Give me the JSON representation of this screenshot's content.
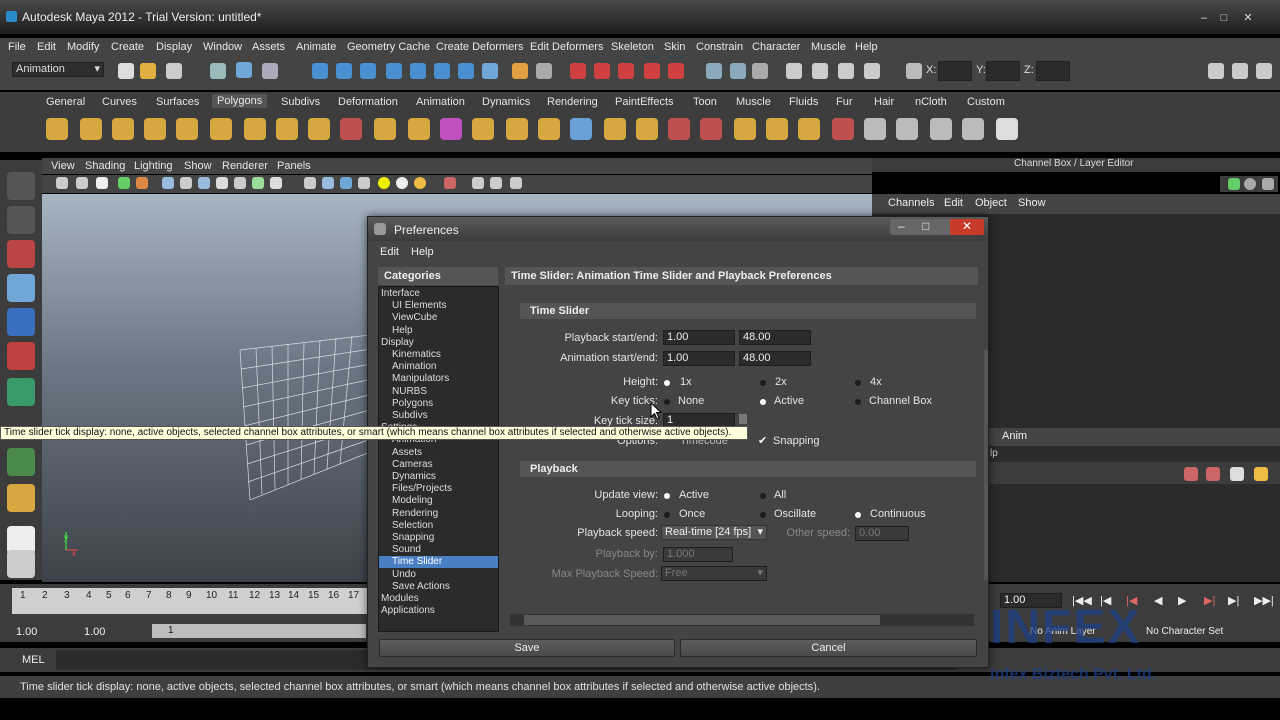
{
  "window": {
    "title": "Autodesk Maya 2012 - Trial Version: untitled*"
  },
  "menubar": [
    "File",
    "Edit",
    "Modify",
    "Create",
    "Display",
    "Window",
    "Assets",
    "Animate",
    "Geometry Cache",
    "Create Deformers",
    "Edit Deformers",
    "Skeleton",
    "Skin",
    "Constrain",
    "Character",
    "Muscle",
    "Help"
  ],
  "toolbar": {
    "mode": "Animation",
    "x_label": "X:",
    "y_label": "Y:",
    "z_label": "Z:"
  },
  "shelf_tabs": [
    "General",
    "Curves",
    "Surfaces",
    "Polygons",
    "Subdivs",
    "Deformation",
    "Animation",
    "Dynamics",
    "Rendering",
    "PaintEffects",
    "Toon",
    "Muscle",
    "Fluids",
    "Fur",
    "Hair",
    "nCloth",
    "Custom"
  ],
  "shelf_active": "Polygons",
  "panel_menu": [
    "View",
    "Shading",
    "Lighting",
    "Show",
    "Renderer",
    "Panels"
  ],
  "channel_box": {
    "title": "Channel Box / Layer Editor",
    "menu": [
      "Channels",
      "Edit",
      "Object",
      "Show"
    ],
    "layer_tab": "Anim",
    "layer_help": "lp"
  },
  "timeline": {
    "ticks": [
      "1",
      "2",
      "3",
      "4",
      "5",
      "6",
      "7",
      "8",
      "9",
      "10",
      "11",
      "12",
      "13",
      "14",
      "15",
      "16",
      "17"
    ],
    "current": "1.00",
    "start": "1.00",
    "range_start": "1.00",
    "range_mark": "1",
    "anim_layer": "No Anim Layer",
    "char_set": "No Character Set"
  },
  "mel_label": "MEL",
  "status_text": "Time slider tick display: none, active objects, selected channel box attributes, or smart (which means channel box attributes if selected and otherwise active objects).",
  "tooltip": "Time slider tick display: none, active objects, selected channel box attributes, or smart (which means channel box attributes if selected and otherwise active objects).",
  "prefs": {
    "title": "Preferences",
    "menu": [
      "Edit",
      "Help"
    ],
    "categories_label": "Categories",
    "categories": [
      {
        "label": "Interface",
        "level": 0
      },
      {
        "label": "UI Elements",
        "level": 1
      },
      {
        "label": "ViewCube",
        "level": 1
      },
      {
        "label": "Help",
        "level": 1
      },
      {
        "label": "Display",
        "level": 0
      },
      {
        "label": "Kinematics",
        "level": 1
      },
      {
        "label": "Animation",
        "level": 1
      },
      {
        "label": "Manipulators",
        "level": 1
      },
      {
        "label": "NURBS",
        "level": 1
      },
      {
        "label": "Polygons",
        "level": 1
      },
      {
        "label": "Subdivs",
        "level": 1
      },
      {
        "label": "Settings",
        "level": 0
      },
      {
        "label": "Animation",
        "level": 1
      },
      {
        "label": "Assets",
        "level": 1
      },
      {
        "label": "Cameras",
        "level": 1
      },
      {
        "label": "Dynamics",
        "level": 1
      },
      {
        "label": "Files/Projects",
        "level": 1
      },
      {
        "label": "Modeling",
        "level": 1
      },
      {
        "label": "Rendering",
        "level": 1
      },
      {
        "label": "Selection",
        "level": 1
      },
      {
        "label": "Snapping",
        "level": 1
      },
      {
        "label": "Sound",
        "level": 1
      },
      {
        "label": "Time Slider",
        "level": 1,
        "selected": true
      },
      {
        "label": "Undo",
        "level": 1
      },
      {
        "label": "Save Actions",
        "level": 1
      },
      {
        "label": "Modules",
        "level": 0
      },
      {
        "label": "Applications",
        "level": 0
      }
    ],
    "section_title": "Time Slider: Animation Time Slider and Playback Preferences",
    "time_slider": {
      "frame": "Time Slider",
      "playback_label": "Playback start/end:",
      "playback_start": "1.00",
      "playback_end": "48.00",
      "anim_label": "Animation start/end:",
      "anim_start": "1.00",
      "anim_end": "48.00",
      "height_label": "Height:",
      "height_opts": [
        "1x",
        "2x",
        "4x"
      ],
      "keyticks_label": "Key ticks:",
      "keyticks_opts": [
        "None",
        "Active",
        "Channel Box"
      ],
      "keysize_label": "Key tick size:",
      "keysize_value": "1",
      "options_label": "Options:",
      "timecode": "Timecode",
      "snapping": "Snapping"
    },
    "playback": {
      "frame": "Playback",
      "update_label": "Update view:",
      "update_opts": [
        "Active",
        "All"
      ],
      "loop_label": "Looping:",
      "loop_opts": [
        "Once",
        "Oscillate",
        "Continuous"
      ],
      "speed_label": "Playback speed:",
      "speed_value": "Real-time [24 fps]",
      "other_label": "Other speed:",
      "other_value": "0.00",
      "by_label": "Playback by:",
      "by_value": "1.000",
      "max_label": "Max Playback Speed:",
      "max_value": "Free"
    },
    "save": "Save",
    "cancel": "Cancel"
  },
  "watermark": {
    "logo": "INFEX",
    "company": "Infex Biztech Pvt. Ltd."
  }
}
